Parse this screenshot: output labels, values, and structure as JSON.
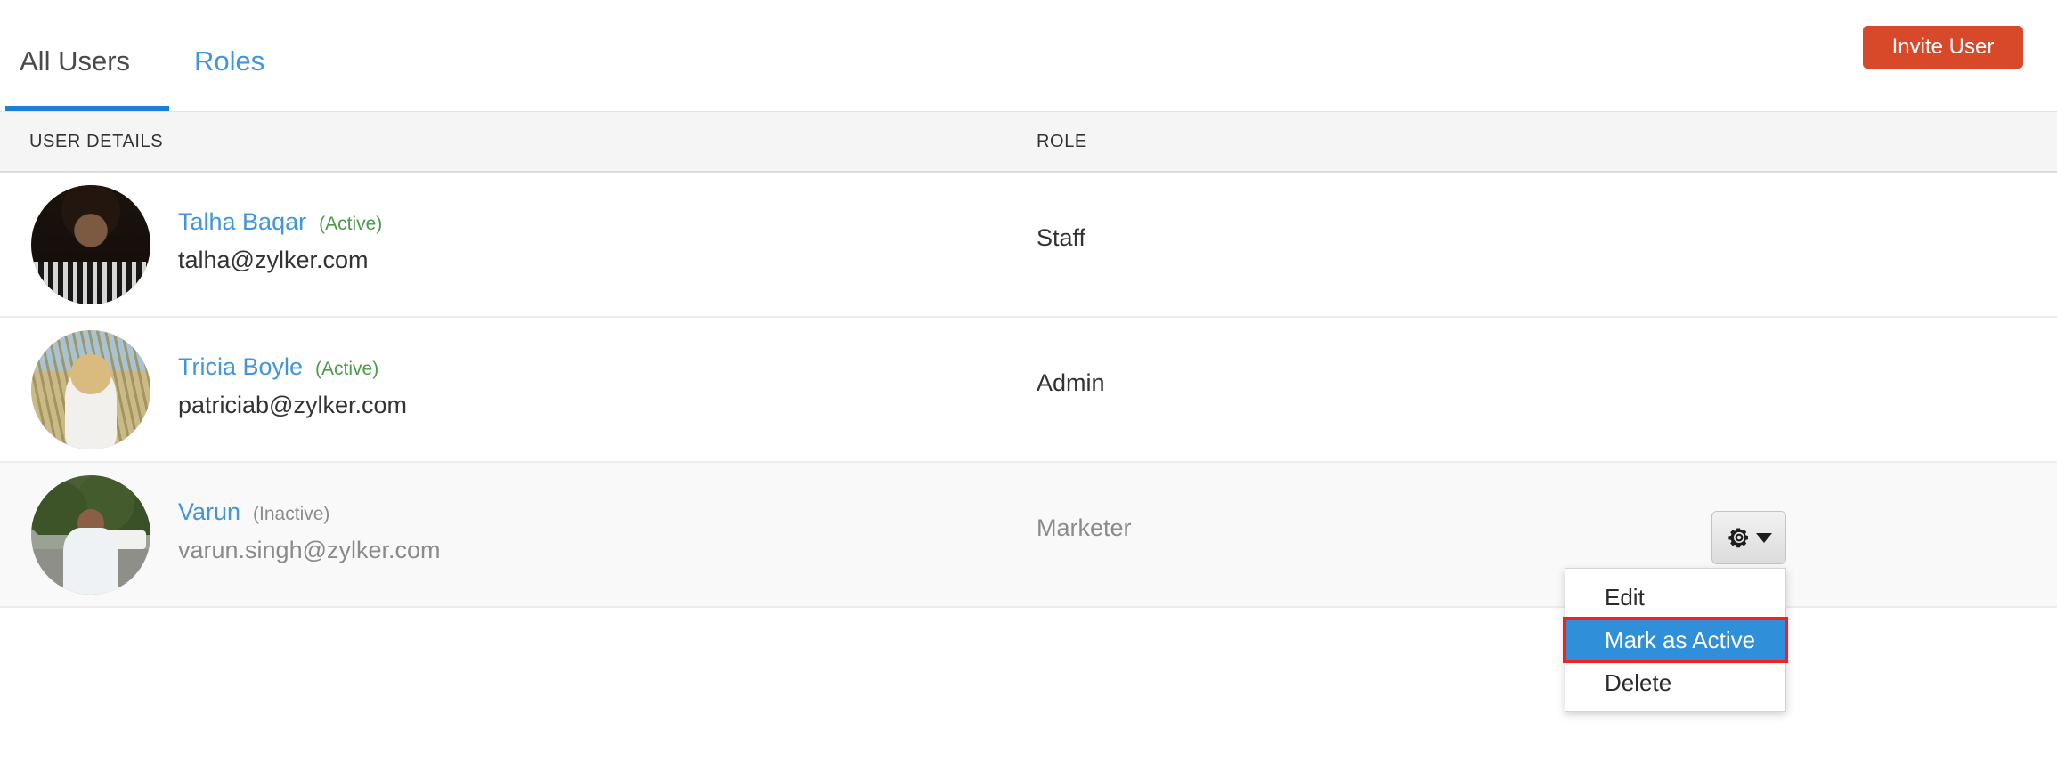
{
  "tabs": [
    {
      "label": "All Users",
      "active": true
    },
    {
      "label": "Roles",
      "active": false
    }
  ],
  "toolbar": {
    "invite_label": "Invite User",
    "invite_color": "#d8492a"
  },
  "table": {
    "columns": [
      "USER DETAILS",
      "ROLE"
    ],
    "rows": [
      {
        "name": "Talha Baqar",
        "status": "(Active)",
        "status_state": "active",
        "email": "talha@zylker.com",
        "role": "Staff"
      },
      {
        "name": "Tricia Boyle",
        "status": "(Active)",
        "status_state": "active",
        "email": "patriciab@zylker.com",
        "role": "Admin"
      },
      {
        "name": "Varun",
        "status": "(Inactive)",
        "status_state": "inactive",
        "email": "varun.singh@zylker.com",
        "role": "Marketer"
      }
    ]
  },
  "actions": {
    "gear_icon": "gear-icon",
    "caret_icon": "chevron-down-icon",
    "menu": [
      {
        "label": "Edit",
        "highlighted": false
      },
      {
        "label": "Mark as Active",
        "highlighted": true
      },
      {
        "label": "Delete",
        "highlighted": false
      }
    ],
    "highlight_bg": "#2f8fd9",
    "highlight_outline": "#f5201d"
  },
  "colors": {
    "link": "#3f96dd",
    "tab_underline": "#1a82d6",
    "active_status": "#4a9a4a",
    "muted": "#8b8b8b",
    "header_bg": "#f5f5f5",
    "inactive_row_bg": "#f9f9f9"
  }
}
